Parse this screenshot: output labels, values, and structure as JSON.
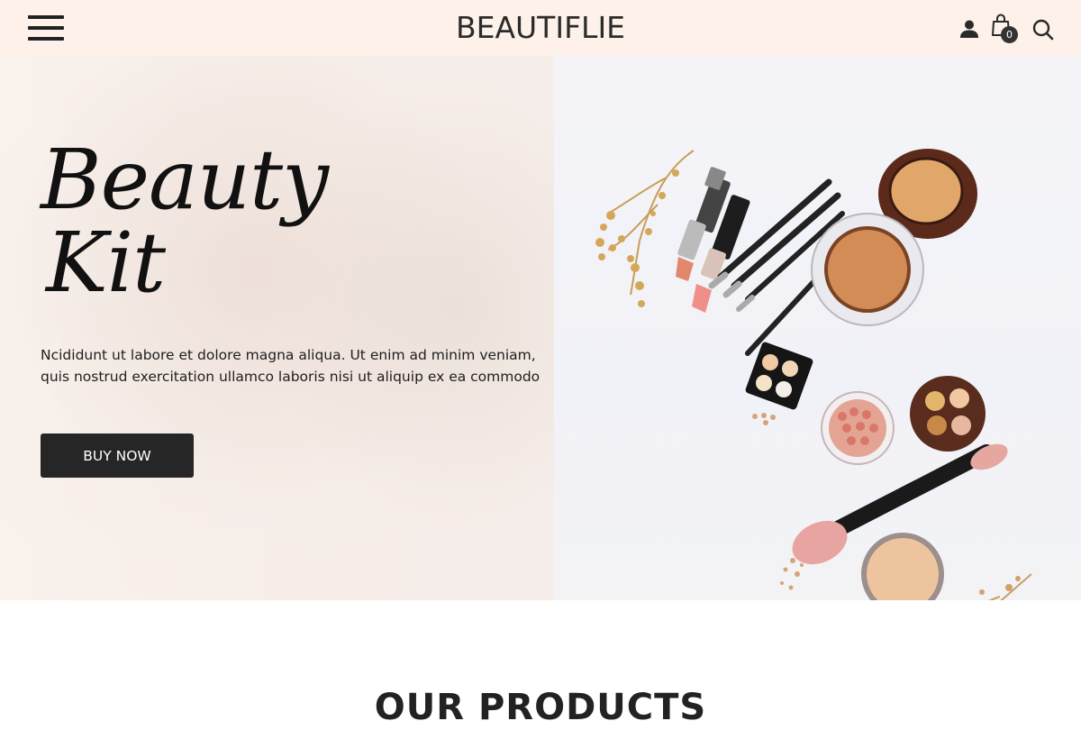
{
  "header": {
    "brand": "BEAUTIFLIE",
    "cart_count": "0",
    "icons": [
      "menu-icon",
      "user-icon",
      "shopping-bag-icon",
      "search-icon"
    ]
  },
  "hero": {
    "title_line1": "Beauty",
    "title_line2": "Kit",
    "description": "Ncididunt ut labore et dolore magna aliqua. Ut enim ad minim veniam, quis nostrud exercitation ullamco laboris nisi ut aliquip ex ea commodo",
    "cta_label": "BUY NOW"
  },
  "products_section": {
    "title": "OUR PRODUCTS"
  },
  "colors": {
    "header_bg": "#fdf1ea",
    "button_bg": "#262626",
    "text_dark": "#222222"
  }
}
